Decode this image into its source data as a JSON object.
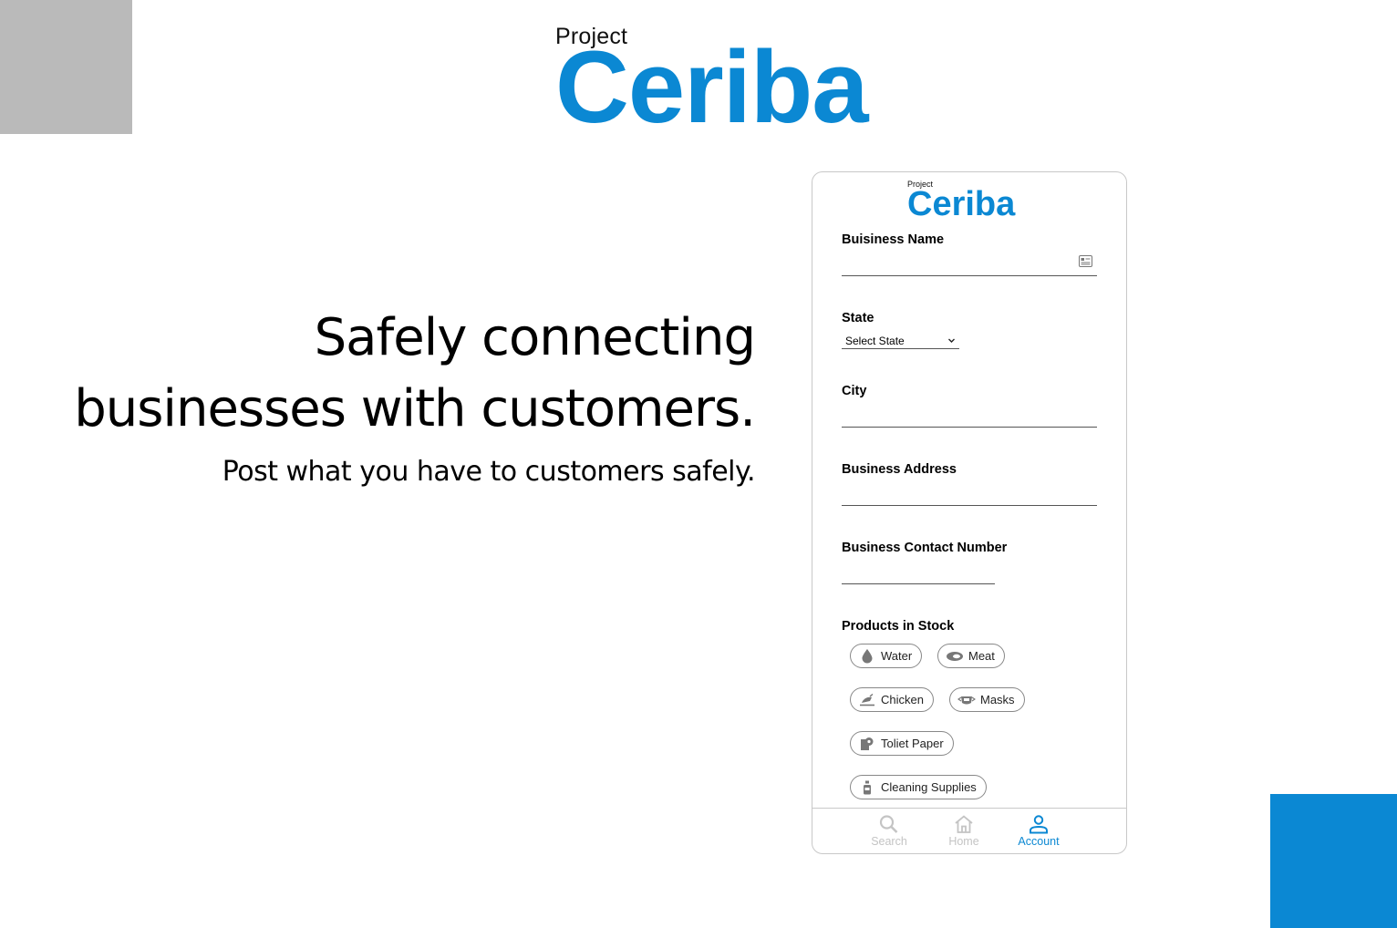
{
  "brand": {
    "small": "Project",
    "big": "Ceriba",
    "accent_color": "#0b88d3"
  },
  "hero": {
    "line1": "Safely connecting",
    "line2": "businesses with customers.",
    "subtitle": "Post what you have to customers safely."
  },
  "phone": {
    "brand_small": "Project",
    "brand_big": "Ceriba",
    "fields": {
      "business_name": {
        "label": "Buisiness Name",
        "icon": "contact-card-icon"
      },
      "state": {
        "label": "State",
        "selected": "Select State"
      },
      "city": {
        "label": "City"
      },
      "business_address": {
        "label": "Business Address"
      },
      "contact_number": {
        "label": "Business Contact Number"
      }
    },
    "products": {
      "label": "Products in Stock",
      "items": [
        {
          "label": "Water",
          "icon": "water-drop-icon"
        },
        {
          "label": "Meat",
          "icon": "meat-icon"
        },
        {
          "label": "Chicken",
          "icon": "chicken-icon"
        },
        {
          "label": "Masks",
          "icon": "mask-icon"
        },
        {
          "label": "Toliet Paper",
          "icon": "toilet-paper-icon"
        },
        {
          "label": "Cleaning Supplies",
          "icon": "spray-bottle-icon"
        }
      ]
    },
    "tabs": [
      {
        "label": "Search",
        "icon": "search-icon",
        "active": false
      },
      {
        "label": "Home",
        "icon": "home-icon",
        "active": false
      },
      {
        "label": "Account",
        "icon": "account-icon",
        "active": true
      }
    ]
  }
}
